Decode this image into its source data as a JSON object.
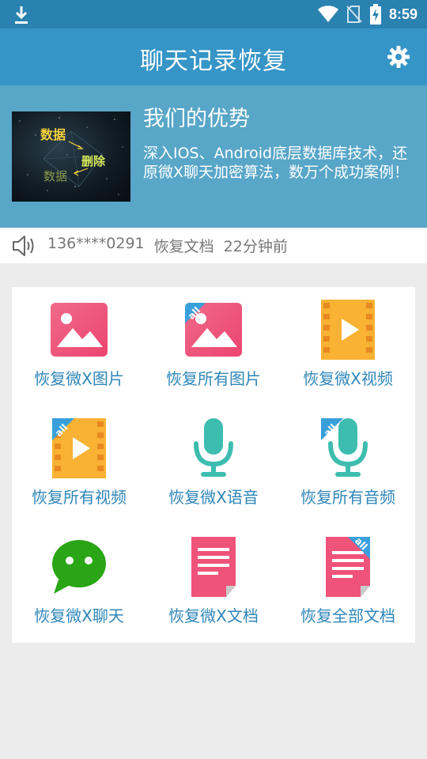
{
  "status_bar": {
    "time": "8:59",
    "icons": [
      "download-icon",
      "wifi-icon",
      "no-sim-icon",
      "battery-charging-icon"
    ]
  },
  "app_bar": {
    "title": "聊天记录恢复",
    "settings_icon": "gear-icon"
  },
  "banner": {
    "image_words": [
      "数据",
      "删除",
      "数据"
    ],
    "headline": "我们的优势",
    "description": "深入IOS、Android底层数据库技术，还原微X聊天加密算法，数万个成功案例！"
  },
  "ticker": {
    "icon": "speaker-icon",
    "phone": "136****0291",
    "action": "恢复文档",
    "time_ago": "22分钟前"
  },
  "grid": {
    "items": [
      {
        "label": "恢复微X图片",
        "icon": "image-icon"
      },
      {
        "label": "恢复所有图片",
        "icon": "all-images-icon"
      },
      {
        "label": "恢复微X视频",
        "icon": "video-icon"
      },
      {
        "label": "恢复所有视频",
        "icon": "all-videos-icon"
      },
      {
        "label": "恢复微X语音",
        "icon": "microphone-icon"
      },
      {
        "label": "恢复所有音频",
        "icon": "all-audio-icon"
      },
      {
        "label": "恢复微X聊天",
        "icon": "chat-bubble-icon"
      },
      {
        "label": "恢复微X文档",
        "icon": "document-icon"
      },
      {
        "label": "恢复全部文档",
        "icon": "all-documents-icon"
      }
    ],
    "corner_badge_text": "all"
  },
  "colors": {
    "status_bar": "#2a82b0",
    "app_bar": "#3595c6",
    "banner": "#58a6c8",
    "label_text": "#2e86b8",
    "pink": "#f0537a",
    "orange": "#f9b234",
    "teal": "#3dbdb0",
    "green": "#2aa515"
  }
}
